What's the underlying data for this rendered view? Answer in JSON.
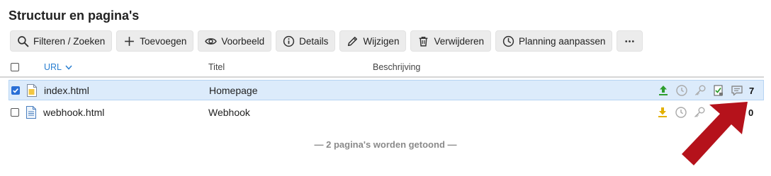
{
  "page": {
    "title": "Structuur en pagina's"
  },
  "toolbar": {
    "filter_label": "Filteren / Zoeken",
    "add_label": "Toevoegen",
    "preview_label": "Voorbeeld",
    "details_label": "Details",
    "edit_label": "Wijzigen",
    "delete_label": "Verwijderen",
    "schedule_label": "Planning aanpassen",
    "more_label": "..."
  },
  "table": {
    "columns": {
      "url": "URL",
      "title": "Titel",
      "description": "Beschrijving"
    },
    "sort_column": "url",
    "rows": [
      {
        "selected": true,
        "url": "index.html",
        "title": "Homepage",
        "description": "",
        "publish_icon": "upload-icon",
        "publish_color": "#2e9e2e",
        "count": "7"
      },
      {
        "selected": false,
        "url": "webhook.html",
        "title": "Webhook",
        "description": "",
        "publish_icon": "download-icon",
        "publish_color": "#e3b000",
        "count": "0"
      }
    ]
  },
  "footer": {
    "summary": "— 2 pagina's worden getoond —"
  },
  "colors": {
    "accent": "#2a7fd1",
    "selection": "#dcebfb",
    "arrow": "#b5121b"
  }
}
